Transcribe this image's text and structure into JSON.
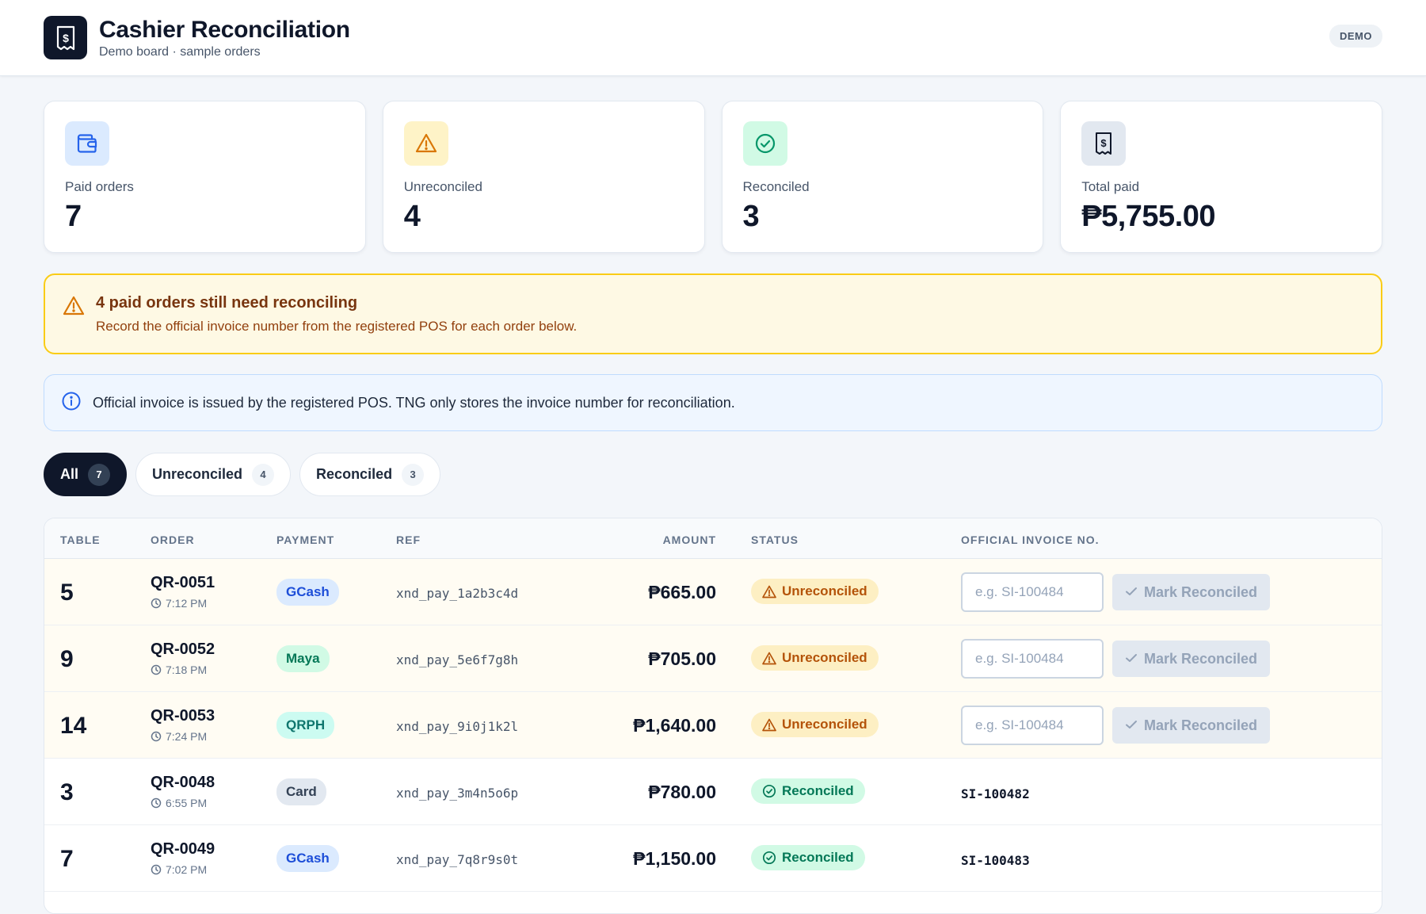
{
  "header": {
    "title": "Cashier Reconciliation",
    "subtitle": "Demo board · sample orders",
    "badge": "DEMO"
  },
  "stats": [
    {
      "label": "Paid orders",
      "value": "7",
      "icon": "wallet-icon",
      "color": "#2563eb",
      "bg": "#dbeafe"
    },
    {
      "label": "Unreconciled",
      "value": "4",
      "icon": "warning-icon",
      "color": "#d97706",
      "bg": "#fef3c7"
    },
    {
      "label": "Reconciled",
      "value": "3",
      "icon": "check-circle-icon",
      "color": "#059669",
      "bg": "#d1fae5"
    },
    {
      "label": "Total paid",
      "value": "₱5,755.00",
      "icon": "receipt-icon",
      "color": "#0f172a",
      "bg": "#e2e8f0"
    }
  ],
  "warning": {
    "title": "4 paid orders still need reconciling",
    "text": "Record the official invoice number from the registered POS for each order below."
  },
  "info": {
    "text": "Official invoice is issued by the registered POS. TNG only stores the invoice number for reconciliation."
  },
  "tabs": [
    {
      "label": "All",
      "count": "7",
      "active": true
    },
    {
      "label": "Unreconciled",
      "count": "4",
      "active": false
    },
    {
      "label": "Reconciled",
      "count": "3",
      "active": false
    }
  ],
  "table": {
    "headers": {
      "table": "TABLE",
      "order": "ORDER",
      "payment": "PAYMENT",
      "ref": "REF",
      "amount": "AMOUNT",
      "status": "STATUS",
      "invoice": "OFFICIAL INVOICE NO."
    },
    "invoice_placeholder": "e.g. SI-100484",
    "mark_label": "Mark Reconciled",
    "rows": [
      {
        "table": "5",
        "order": "QR-0051",
        "time": "7:12 PM",
        "payment": "GCash",
        "ref": "xnd_pay_1a2b3c4d",
        "amount": "₱665.00",
        "status": "Unreconciled",
        "reconciled": false,
        "invoice": ""
      },
      {
        "table": "9",
        "order": "QR-0052",
        "time": "7:18 PM",
        "payment": "Maya",
        "ref": "xnd_pay_5e6f7g8h",
        "amount": "₱705.00",
        "status": "Unreconciled",
        "reconciled": false,
        "invoice": ""
      },
      {
        "table": "14",
        "order": "QR-0053",
        "time": "7:24 PM",
        "payment": "QRPH",
        "ref": "xnd_pay_9i0j1k2l",
        "amount": "₱1,640.00",
        "status": "Unreconciled",
        "reconciled": false,
        "invoice": ""
      },
      {
        "table": "3",
        "order": "QR-0048",
        "time": "6:55 PM",
        "payment": "Card",
        "ref": "xnd_pay_3m4n5o6p",
        "amount": "₱780.00",
        "status": "Reconciled",
        "reconciled": true,
        "invoice": "SI-100482"
      },
      {
        "table": "7",
        "order": "QR-0049",
        "time": "7:02 PM",
        "payment": "GCash",
        "ref": "xnd_pay_7q8r9s0t",
        "amount": "₱1,150.00",
        "status": "Reconciled",
        "reconciled": true,
        "invoice": "SI-100483"
      }
    ]
  },
  "payment_colors": {
    "GCash": {
      "bg": "#dbeafe",
      "fg": "#1d4ed8"
    },
    "Maya": {
      "bg": "#d1fae5",
      "fg": "#047857"
    },
    "QRPH": {
      "bg": "#ccfbf1",
      "fg": "#0f766e"
    },
    "Card": {
      "bg": "#e2e8f0",
      "fg": "#334155"
    }
  }
}
